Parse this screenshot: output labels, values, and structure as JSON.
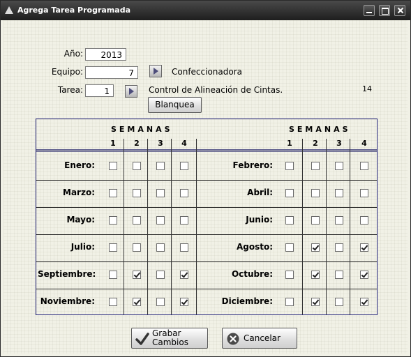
{
  "window": {
    "title": "Agrega Tarea Programada"
  },
  "form": {
    "anio_label": "Año:",
    "anio_value": "2013",
    "equipo_label": "Equipo:",
    "equipo_value": "7",
    "equipo_name": "Confeccionadora",
    "tarea_label": "Tarea:",
    "tarea_value": "1",
    "tarea_name": "Control de Alineación de Cintas.",
    "count": "14",
    "blanquea_label": "Blanquea"
  },
  "schedule": {
    "semanas_label": "SEMANAS",
    "week_numbers": [
      "1",
      "2",
      "3",
      "4"
    ],
    "months": [
      {
        "name": "Enero:",
        "weeks": [
          false,
          false,
          false,
          false
        ]
      },
      {
        "name": "Febrero:",
        "weeks": [
          false,
          false,
          false,
          false
        ]
      },
      {
        "name": "Marzo:",
        "weeks": [
          false,
          false,
          false,
          false
        ]
      },
      {
        "name": "Abril:",
        "weeks": [
          false,
          false,
          false,
          false
        ]
      },
      {
        "name": "Mayo:",
        "weeks": [
          false,
          false,
          false,
          false
        ]
      },
      {
        "name": "Junio:",
        "weeks": [
          false,
          false,
          false,
          false
        ]
      },
      {
        "name": "Julio:",
        "weeks": [
          false,
          false,
          false,
          false
        ]
      },
      {
        "name": "Agosto:",
        "weeks": [
          false,
          true,
          false,
          true
        ]
      },
      {
        "name": "Septiembre:",
        "weeks": [
          false,
          true,
          false,
          true
        ]
      },
      {
        "name": "Octubre:",
        "weeks": [
          false,
          true,
          false,
          true
        ]
      },
      {
        "name": "Noviembre:",
        "weeks": [
          false,
          true,
          false,
          true
        ]
      },
      {
        "name": "Diciembre:",
        "weeks": [
          false,
          true,
          false,
          true
        ]
      }
    ]
  },
  "actions": {
    "grabar_line1": "Grabar",
    "grabar_line2": "Cambios",
    "cancelar_label": "Cancelar"
  },
  "icons": {
    "window_icon": "triangle-icon",
    "lookup": "play-arrow-icon",
    "grabar": "check-icon",
    "cancelar": "x-circle-icon"
  }
}
